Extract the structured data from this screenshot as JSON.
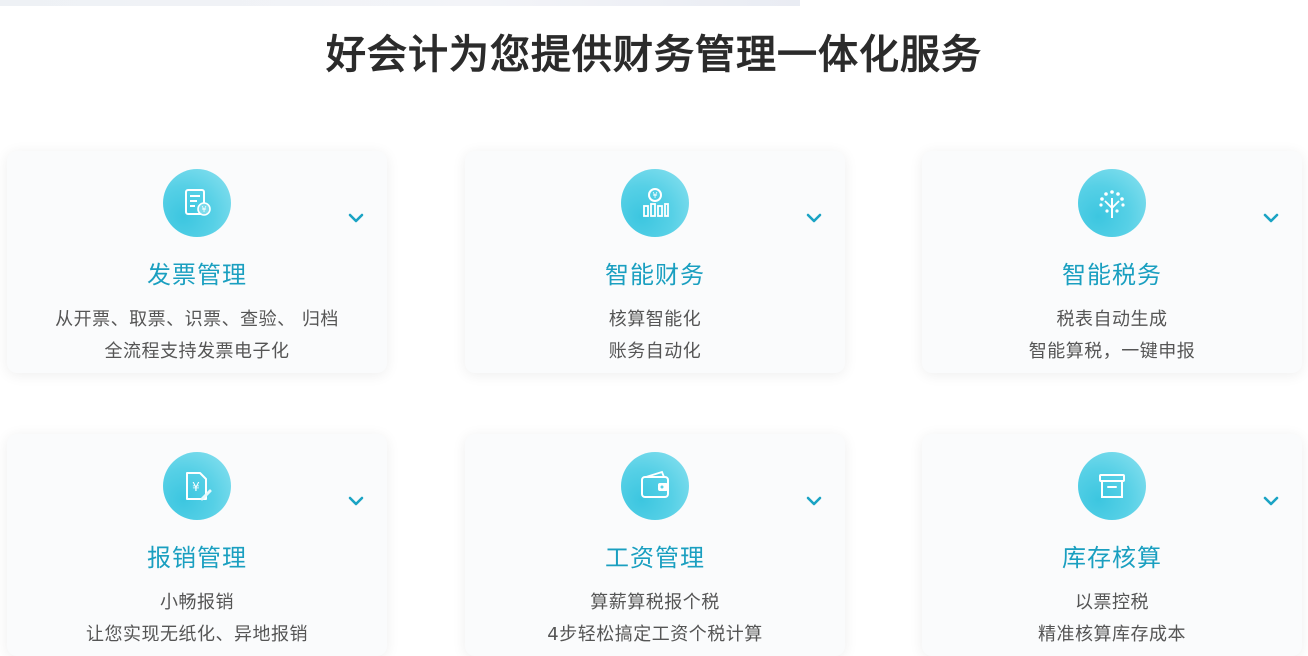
{
  "page": {
    "title": "好会计为您提供财务管理一体化服务"
  },
  "cards": [
    {
      "icon": "invoice-receipt-icon",
      "title": "发票管理",
      "line1": "从开票、取票、识票、查验、 归档",
      "line2": "全流程支持发票电子化"
    },
    {
      "icon": "finance-chart-icon",
      "title": "智能财务",
      "line1": "核算智能化",
      "line2": "账务自动化"
    },
    {
      "icon": "tax-tree-icon",
      "title": "智能税务",
      "line1": "税表自动生成",
      "line2": "智能算税，一键申报"
    },
    {
      "icon": "expense-document-icon",
      "title": "报销管理",
      "line1": "小畅报销",
      "line2": "让您实现无纸化、异地报销"
    },
    {
      "icon": "wallet-icon",
      "title": "工资管理",
      "line1": "算薪算税报个税",
      "line2": "4步轻松搞定工资个税计算"
    },
    {
      "icon": "inventory-box-icon",
      "title": "库存核算",
      "line1": "以票控税",
      "line2": "精准核算库存成本"
    }
  ],
  "colors": {
    "accent": "#1a9fc0",
    "icon_bg": "#56d0e6",
    "title": "#2b2b2b",
    "text": "#555555"
  }
}
